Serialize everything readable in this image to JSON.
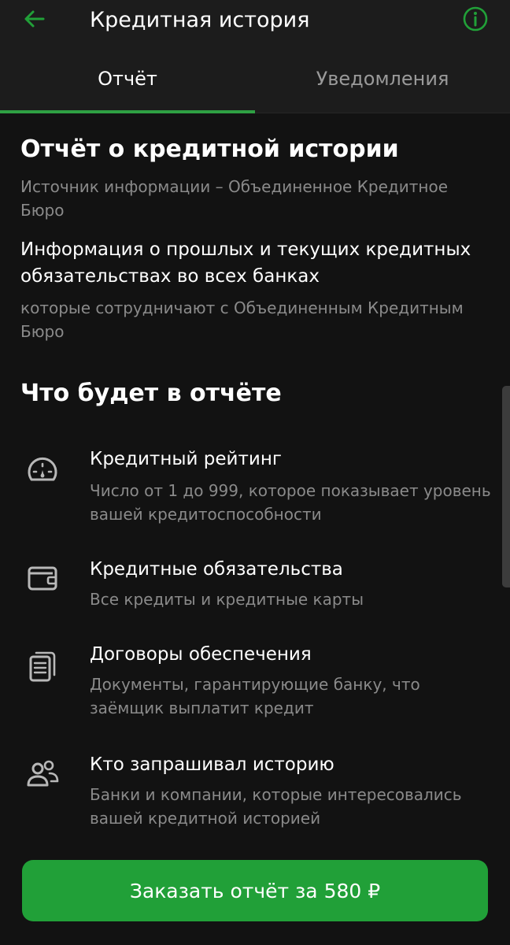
{
  "header": {
    "title": "Кредитная история",
    "back_icon": "arrow-left-icon",
    "info_icon": "info-circle-icon"
  },
  "tabs": [
    {
      "label": "Отчёт",
      "active": true
    },
    {
      "label": "Уведомления",
      "active": false
    }
  ],
  "report": {
    "title": "Отчёт о кредитной истории",
    "source": "Источник информации – Объединенное Кредитное Бюро",
    "lead": "Информация о прошлых и текущих кредитных обязательствах во всех банках",
    "lead_note": "которые сотрудничают с Объединенным Кредитным Бюро"
  },
  "contents": {
    "title": "Что будет в отчёте",
    "items": [
      {
        "icon": "speedometer-icon",
        "title": "Кредитный рейтинг",
        "description": "Число от 1 до 999, которое показывает уровень вашей кредитоспособности"
      },
      {
        "icon": "wallet-icon",
        "title": "Кредитные обязательства",
        "description": "Все кредиты и кредитные карты"
      },
      {
        "icon": "documents-icon",
        "title": "Договоры обеспечения",
        "description": "Документы, гарантирующие банку, что заёмщик выплатит кредит"
      },
      {
        "icon": "people-icon",
        "title": "Кто запрашивал историю",
        "description": "Банки и компании, которые интересовались вашей кредитной историей"
      }
    ]
  },
  "cta": {
    "label": "Заказать отчёт за 580 ₽"
  },
  "colors": {
    "accent": "#21a038",
    "background": "#121212",
    "bar": "#1c1c1c",
    "text_primary": "#ffffff",
    "text_secondary": "#8a8a8a"
  }
}
